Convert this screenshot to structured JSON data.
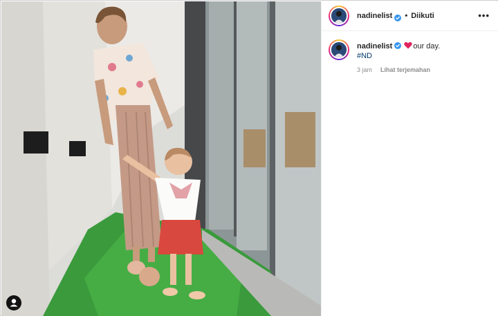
{
  "post": {
    "username": "nadinelist",
    "follow_status": "Diikuti",
    "separator": "•",
    "more_label": "•••",
    "caption_text": "our day.",
    "hashtag": "#ND",
    "time_ago": "3 jam",
    "translate_label": "Lihat terjemahan"
  },
  "icons": {
    "verified": "verified-badge-icon",
    "heart": "red-heart-emoji-icon",
    "more": "more-options-icon",
    "user_tag": "user-tag-icon"
  },
  "colors": {
    "verified_blue": "#3897f0",
    "heart_red": "#e0245e",
    "hashtag_blue": "#00376b",
    "muted_gray": "#8e8e8e",
    "text": "#262626"
  }
}
